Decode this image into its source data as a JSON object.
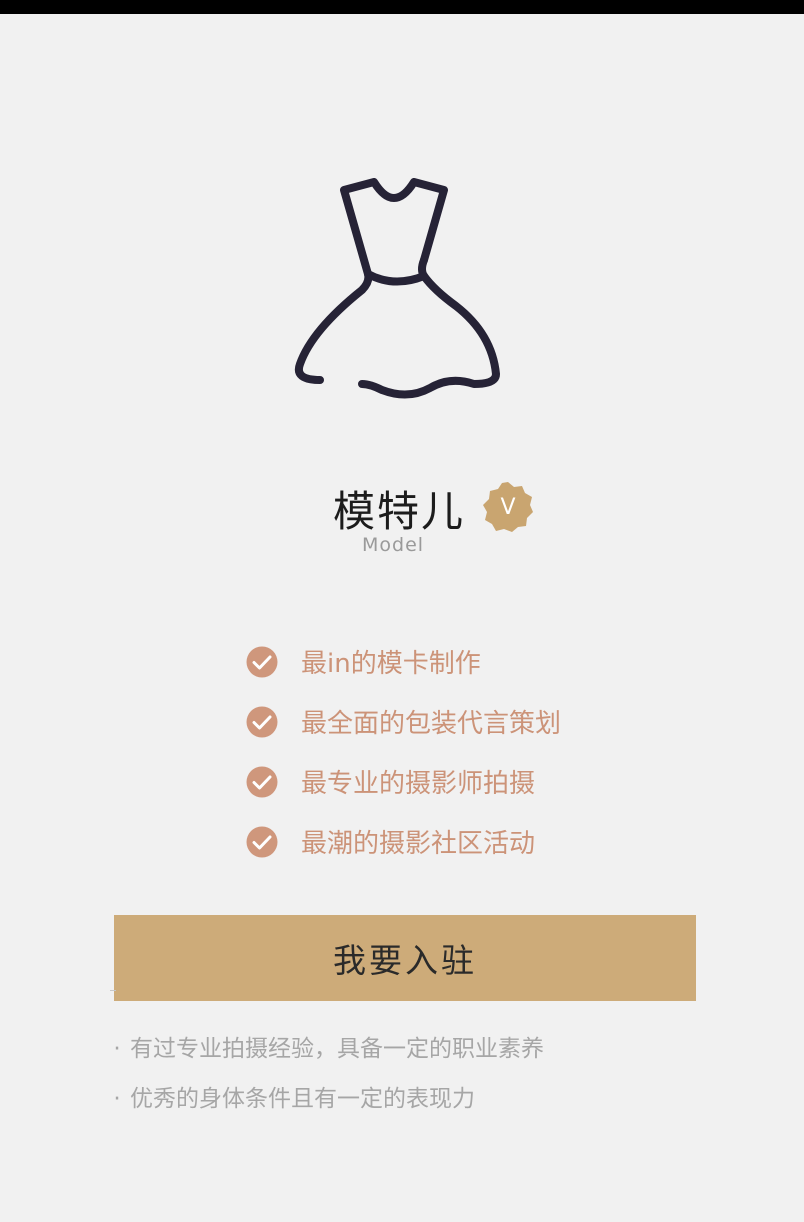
{
  "header": {
    "title": "模特儿",
    "subtitle": "Model",
    "badge_glyph": "V"
  },
  "features": [
    {
      "label": "最in的模卡制作",
      "icon": "check-circle-icon"
    },
    {
      "label": "最全面的包装代言策划",
      "icon": "check-circle-icon"
    },
    {
      "label": "最专业的摄影师拍摄",
      "icon": "check-circle-icon"
    },
    {
      "label": "最潮的摄影社区活动",
      "icon": "check-circle-icon"
    }
  ],
  "join_button": {
    "label": "我要入驻"
  },
  "requirements": [
    {
      "bullet": "·",
      "text": "有过专业拍摄经验，具备一定的职业素养"
    },
    {
      "bullet": "·",
      "text": "优秀的身体条件且有一定的表现力"
    }
  ],
  "colors": {
    "background": "#f1f1f1",
    "accent_gold": "#cdab79",
    "badge_gold": "#c9a570",
    "feature_text": "#cc9378",
    "check_fill": "#cf977c",
    "dress_stroke": "#262336",
    "hint_text": "#a6a6a6"
  },
  "icons": {
    "main": "dress-icon",
    "verified": "verified-badge-icon"
  }
}
